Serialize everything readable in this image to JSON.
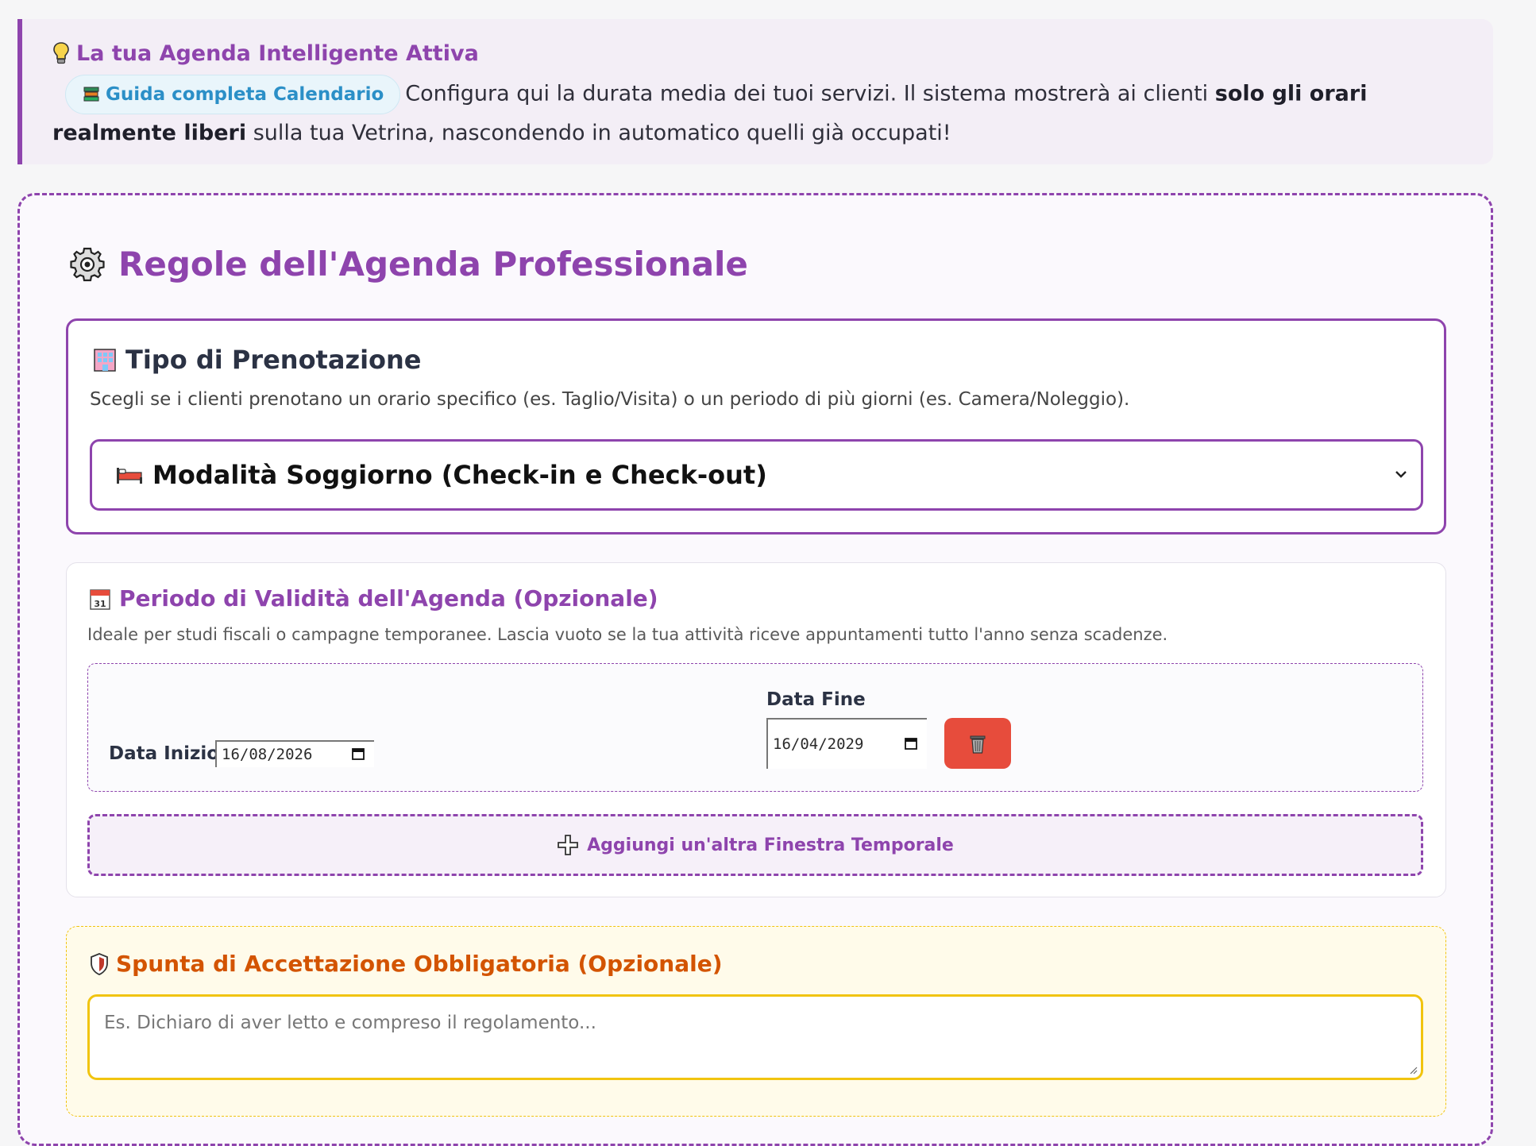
{
  "banner": {
    "title": "La tua Agenda Intelligente Attiva",
    "guide_link": "Guida completa Calendario",
    "text_part1": "Configura qui la durata media dei tuoi servizi. Il sistema mostrerà ai clienti ",
    "text_bold": "solo gli orari realmente liberi",
    "text_part2": " sulla tua Vetrina, nascondendo in automatico quelli già occupati!"
  },
  "rules": {
    "title": "Regole dell'Agenda Professionale",
    "booking_type": {
      "title": "Tipo di Prenotazione",
      "description": "Scegli se i clienti prenotano un orario specifico (es. Taglio/Visita) o un periodo di più giorni (es. Camera/Noleggio).",
      "selected": "Modalità Soggiorno (Check-in e Check-out)"
    },
    "validity": {
      "title": "Periodo di Validità dell'Agenda (Opzionale)",
      "description": "Ideale per studi fiscali o campagne temporanee. Lascia vuoto se la tua attività riceve appuntamenti tutto l'anno senza scadenze.",
      "start_label": "Data Inizio",
      "start_value": "16/08/2026",
      "end_label": "Data Fine",
      "end_value": "16/04/2029",
      "add_window": "Aggiungi un'altra Finestra Temporale"
    },
    "acceptance": {
      "title": "Spunta di Accettazione Obbligatoria (Opzionale)",
      "placeholder": "Es. Dichiaro di aver letto e compreso il regolamento..."
    }
  },
  "colors": {
    "accent": "#8e44ad",
    "danger": "#e74c3c",
    "warning": "#f1c40f",
    "warning_text": "#d35400",
    "link": "#2b8fc7"
  }
}
